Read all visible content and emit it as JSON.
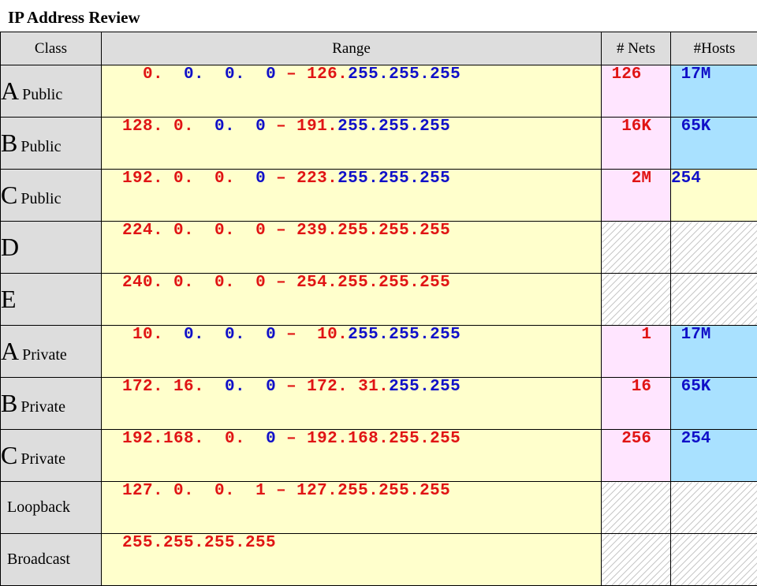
{
  "title": "IP Address Review",
  "headers": {
    "class": "Class",
    "range": "Range",
    "nets": "# Nets",
    "hosts": "#Hosts"
  },
  "rows": [
    {
      "class_letter": "A",
      "class_sub": "Public",
      "range": [
        " 0. ",
        " 0. ",
        " 0. ",
        " 0 ",
        "–",
        " 126.",
        "255.255.255"
      ],
      "nets": " 126",
      "hosts": " 17M"
    },
    {
      "class_letter": "B",
      "class_sub": "Public",
      "range": [
        "128. ",
        "0. ",
        " 0. ",
        " 0 ",
        "–",
        " 191.",
        "255.255.255"
      ],
      "nets": "  16K",
      "hosts": " 65K"
    },
    {
      "class_letter": "C",
      "class_sub": "Public",
      "range": [
        "192. ",
        "0. ",
        " 0. ",
        " 0 ",
        "–",
        " 223.",
        "255.255.255"
      ],
      "nets": "   2M",
      "hosts": "254"
    },
    {
      "class_letter": "D",
      "class_sub": "",
      "range": [
        "224. ",
        "0. ",
        " 0. ",
        " 0 ",
        "–",
        " 239.255.255.255",
        ""
      ],
      "nets": "",
      "hosts": ""
    },
    {
      "class_letter": "E",
      "class_sub": "",
      "range": [
        "240. ",
        "0. ",
        " 0. ",
        " 0 ",
        "–",
        " 254.255.255.255",
        ""
      ],
      "nets": "",
      "hosts": ""
    },
    {
      "class_letter": "A",
      "class_sub": "Private",
      "range": [
        " 10. ",
        " 0. ",
        " 0. ",
        " 0 ",
        "–",
        "  10.",
        "255.255.255"
      ],
      "nets": "    1",
      "hosts": " 17M"
    },
    {
      "class_letter": "B",
      "class_sub": "Private",
      "range": [
        "172. 16. ",
        "",
        " 0. ",
        " 0 ",
        "–",
        " 172. 31.",
        "255.255"
      ],
      "nets": "   16",
      "hosts": " 65K"
    },
    {
      "class_letter": "C",
      "class_sub": "Private",
      "range": [
        "192.168. ",
        "",
        " 0. ",
        " 0 ",
        "–",
        " 192.168.",
        "255.255"
      ],
      "nets": "  256",
      "hosts": " 254"
    },
    {
      "class_word": "Loopback",
      "range": [
        "127. ",
        "0. ",
        " 0. ",
        " 1 ",
        "–",
        " 127.255.255.255",
        ""
      ],
      "nets": "",
      "hosts": ""
    },
    {
      "class_word": "Broadcast",
      "range": [
        "255.255.255.255",
        "",
        "",
        "",
        "",
        "",
        ""
      ],
      "nets": "",
      "hosts": ""
    }
  ],
  "colors": {
    "red": "#e01414",
    "blue": "#1010c8",
    "class_bg": "#dddddd",
    "range_bg": "#ffffcc",
    "nets_bg": "#ffe5ff",
    "hosts_bg": "#a9e1ff"
  }
}
